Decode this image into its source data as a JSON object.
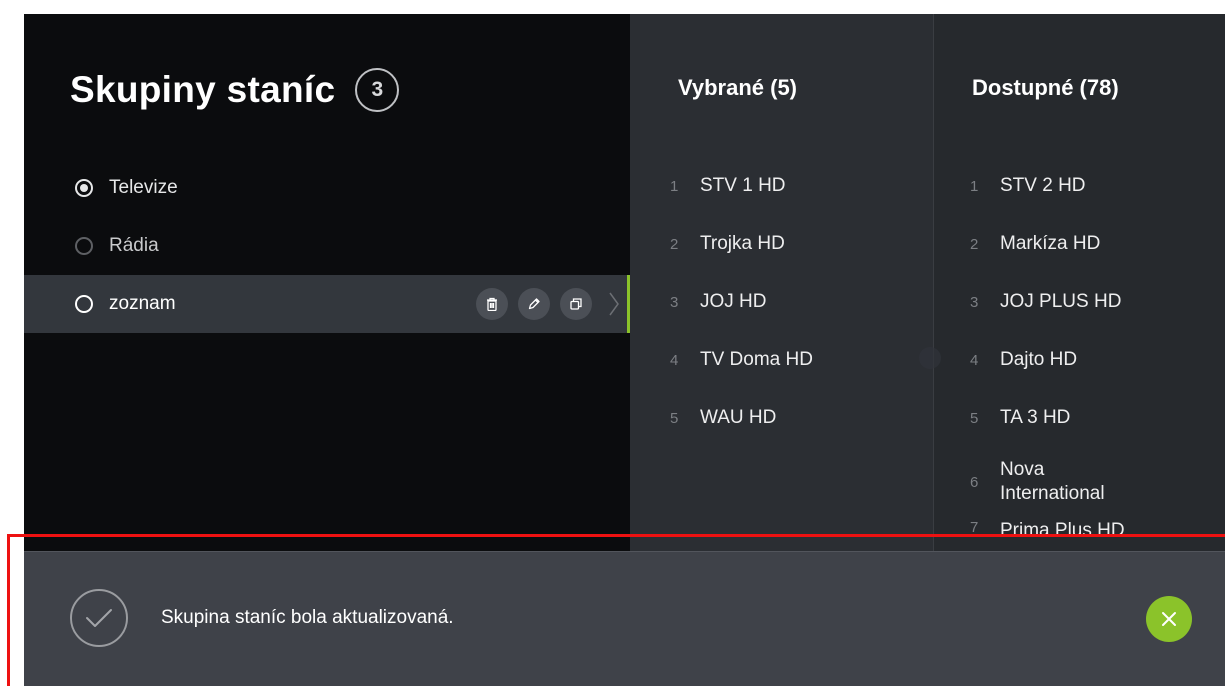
{
  "header": {
    "title": "Skupiny staníc",
    "count": "3"
  },
  "groups": [
    {
      "label": "Televize",
      "state": "active"
    },
    {
      "label": "Rádia",
      "state": "inactive"
    },
    {
      "label": "zoznam",
      "state": "selected"
    }
  ],
  "group_actions": {
    "delete_icon": "trash-icon",
    "edit_icon": "pencil-icon",
    "copy_icon": "duplicate-icon",
    "open_icon": "chevron-right-icon"
  },
  "selected_column": {
    "title": "Vybrané (5)",
    "channels": [
      {
        "num": "1",
        "name": "STV 1 HD"
      },
      {
        "num": "2",
        "name": "Trojka HD"
      },
      {
        "num": "3",
        "name": "JOJ HD"
      },
      {
        "num": "4",
        "name": "TV Doma HD"
      },
      {
        "num": "5",
        "name": "WAU HD"
      }
    ]
  },
  "available_column": {
    "title": "Dostupné (78)",
    "channels": [
      {
        "num": "1",
        "name": "STV 2 HD"
      },
      {
        "num": "2",
        "name": "Markíza HD"
      },
      {
        "num": "3",
        "name": "JOJ PLUS HD"
      },
      {
        "num": "4",
        "name": "Dajto HD"
      },
      {
        "num": "5",
        "name": "TA 3 HD"
      },
      {
        "num": "6",
        "name": "Nova International"
      },
      {
        "num": "7",
        "name": "Prima Plus HD"
      }
    ]
  },
  "toast": {
    "message": "Skupina staníc bola aktualizovaná.",
    "icon": "check-circle-icon",
    "close_icon": "close-icon"
  },
  "colors": {
    "accent": "#8bc32a",
    "highlight": "#ee1111"
  }
}
